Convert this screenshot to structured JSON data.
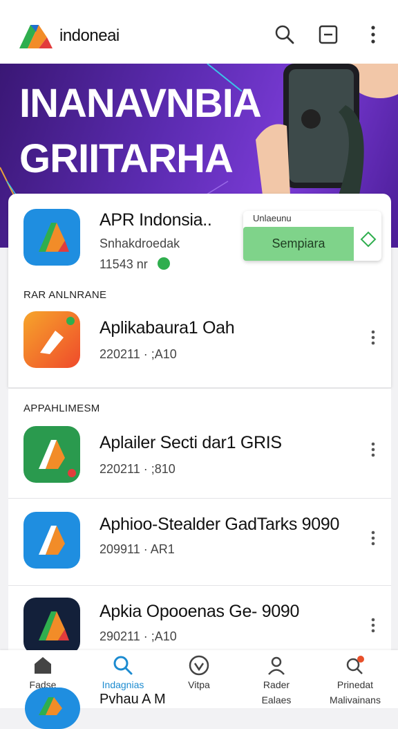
{
  "header": {
    "brand": "indoneai",
    "icons": [
      "search-icon",
      "minus-box-icon",
      "more-vert-icon"
    ]
  },
  "banner": {
    "line1": "INANAVNBIA",
    "line2": "GRIITARHA"
  },
  "featured": {
    "title": "APR Indonsia..",
    "subtitle": "Snhakdroedak",
    "meta": "11543 nr",
    "popup_head": "Unlaeunu",
    "popup_button": "Sempiara"
  },
  "sections": [
    {
      "label": "RAR ANLNRANE",
      "apps": [
        {
          "title": "Aplikabaura1 Oah",
          "meta": "220211 · ;A10"
        }
      ]
    },
    {
      "label": "APPAHLIMESM",
      "apps": [
        {
          "title": "Aplailer Secti dar1 GRIS",
          "meta": "220211 · ;810"
        },
        {
          "title": "Aphioo-Stealder GadTarks 9090",
          "meta": "209911 · AR1"
        },
        {
          "title": "Apkia Opooenas Ge- 9090",
          "meta": "290211 · ;A10"
        }
      ]
    }
  ],
  "bottom_nav": [
    {
      "label": "Fadse",
      "sub": "",
      "icon": "home-icon"
    },
    {
      "label": "Indagnias",
      "sub": "",
      "icon": "search-icon"
    },
    {
      "label": "Vitpa",
      "sub": "",
      "icon": "check-circle-icon"
    },
    {
      "label": "Rader",
      "sub": "Ealaes",
      "icon": "person-icon"
    },
    {
      "label": "Prinedat",
      "sub": "Malivainans",
      "icon": "search-notify-icon"
    }
  ],
  "peek": {
    "label": "Pvhau A M"
  },
  "colors": {
    "accent": "#1c8bd0",
    "banner": "#5b2bb0",
    "popup_green": "#7fd38a"
  }
}
